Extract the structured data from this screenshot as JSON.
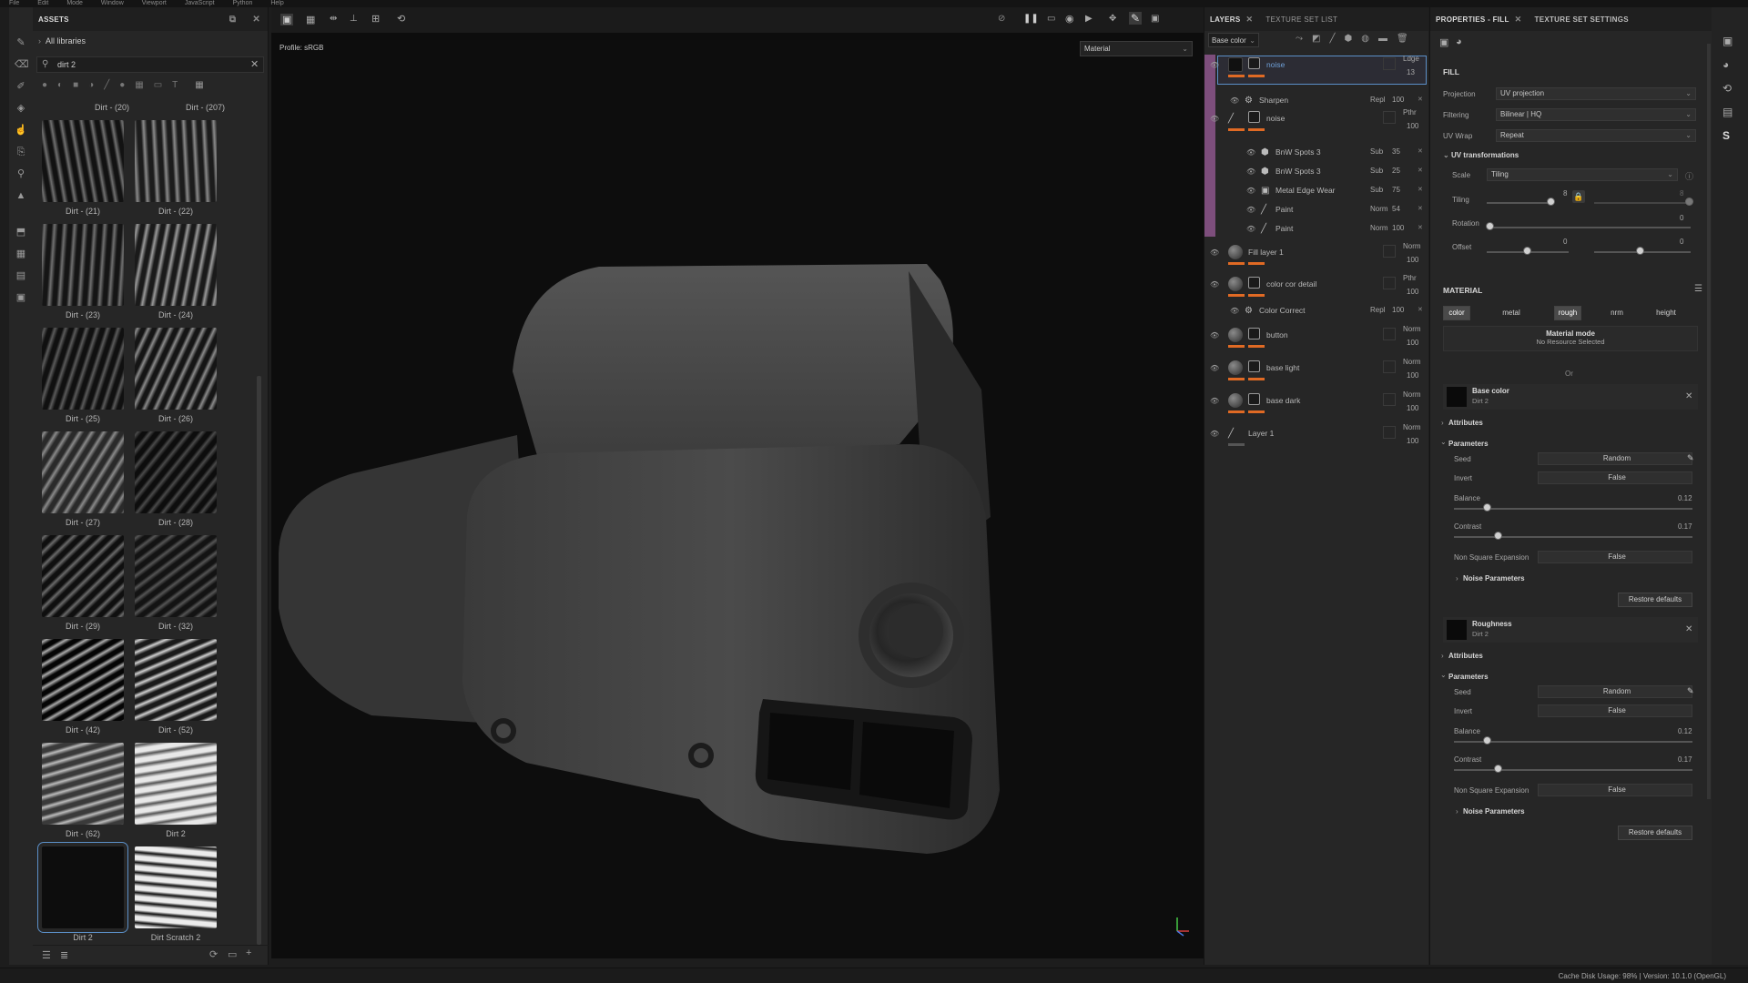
{
  "menubar": {
    "items": [
      "File",
      "Edit",
      "Mode",
      "Window",
      "Viewport",
      "JavaScript",
      "Python",
      "Help"
    ]
  },
  "assets": {
    "title": "ASSETS",
    "breadcrumb": "All libraries",
    "search_value": "dirt 2",
    "top_labels": [
      "Dirt - (20)",
      "Dirt - (207)"
    ],
    "items": [
      {
        "label": "Dirt - (21)"
      },
      {
        "label": "Dirt - (22)"
      },
      {
        "label": "Dirt - (23)"
      },
      {
        "label": "Dirt - (24)"
      },
      {
        "label": "Dirt - (25)"
      },
      {
        "label": "Dirt - (26)"
      },
      {
        "label": "Dirt - (27)"
      },
      {
        "label": "Dirt - (28)"
      },
      {
        "label": "Dirt - (29)"
      },
      {
        "label": "Dirt - (32)"
      },
      {
        "label": "Dirt - (42)"
      },
      {
        "label": "Dirt - (52)"
      },
      {
        "label": "Dirt - (62)"
      },
      {
        "label": "Dirt 2"
      },
      {
        "label": "Dirt 2"
      },
      {
        "label": "Dirt Scratch 2"
      }
    ]
  },
  "viewport": {
    "profile": "Profile: sRGB",
    "mode_select": "Material"
  },
  "layers": {
    "tab_layers": "LAYERS",
    "tab_texture_set_list": "TEXTURE SET LIST",
    "channel_select": "Base color",
    "rows": [
      {
        "name": "noise",
        "blend": "Ldge",
        "opacity": "13",
        "level": 0,
        "thumb": "dark",
        "selected": true
      },
      {
        "name": "Sharpen",
        "blend": "Repl",
        "opacity": "100",
        "level": 1,
        "thumb": "filter"
      },
      {
        "name": "noise",
        "blend": "Pthr",
        "opacity": "100",
        "level": 0,
        "thumb": "brush"
      },
      {
        "name": "BnW Spots 3",
        "blend": "Sub",
        "opacity": "35",
        "level": 2,
        "thumb": "fill"
      },
      {
        "name": "BnW Spots 3",
        "blend": "Sub",
        "opacity": "25",
        "level": 2,
        "thumb": "fill"
      },
      {
        "name": "Metal Edge Wear",
        "blend": "Sub",
        "opacity": "75",
        "level": 2,
        "thumb": "generator"
      },
      {
        "name": "Paint",
        "blend": "Norm",
        "opacity": "54",
        "level": 2,
        "thumb": "brush"
      },
      {
        "name": "Paint",
        "blend": "Norm",
        "opacity": "100",
        "level": 2,
        "thumb": "brush"
      },
      {
        "name": "Fill layer 1",
        "blend": "Norm",
        "opacity": "100",
        "level": 0,
        "thumb": "sphere"
      },
      {
        "name": "color cor detail",
        "blend": "Pthr",
        "opacity": "100",
        "level": 0,
        "thumb": "sphere"
      },
      {
        "name": "Color Correct",
        "blend": "Repl",
        "opacity": "100",
        "level": 1,
        "thumb": "filter"
      },
      {
        "name": "button",
        "blend": "Norm",
        "opacity": "100",
        "level": 0,
        "thumb": "sphere"
      },
      {
        "name": "base light",
        "blend": "Norm",
        "opacity": "100",
        "level": 0,
        "thumb": "sphere"
      },
      {
        "name": "base dark",
        "blend": "Norm",
        "opacity": "100",
        "level": 0,
        "thumb": "sphere"
      },
      {
        "name": "Layer 1",
        "blend": "Norm",
        "opacity": "100",
        "level": 0,
        "thumb": "brush"
      }
    ]
  },
  "properties": {
    "tab_props": "PROPERTIES - FILL",
    "tab_tss": "TEXTURE SET SETTINGS",
    "fill_title": "FILL",
    "projection_label": "Projection",
    "projection_value": "UV projection",
    "filtering_label": "Filtering",
    "filtering_value": "Bilinear | HQ",
    "uvwrap_label": "UV Wrap",
    "uvwrap_value": "Repeat",
    "uvtrans_title": "UV transformations",
    "scale_label": "Scale",
    "scale_value": "Tiling",
    "tiling_label": "Tiling",
    "tiling_val1": "8",
    "tiling_val2": "8",
    "rotation_label": "Rotation",
    "rotation_val": "0",
    "offset_label": "Offset",
    "offset_val1": "0",
    "offset_val2": "0",
    "material_title": "MATERIAL",
    "channels": [
      "color",
      "metal",
      "rough",
      "nrm",
      "height"
    ],
    "material_mode": "Material mode",
    "no_resource": "No Resource Selected",
    "or_text": "Or",
    "base_color": {
      "title": "Base color",
      "sub": "Dirt 2"
    },
    "roughness": {
      "title": "Roughness",
      "sub": "Dirt 2"
    },
    "attributes": "Attributes",
    "parameters": "Parameters",
    "seed_label": "Seed",
    "seed_value": "Random",
    "invert_label": "Invert",
    "invert_value": "False",
    "balance_label": "Balance",
    "balance_value": "0.12",
    "contrast_label": "Contrast",
    "contrast_value": "0.17",
    "nse_label": "Non Square Expansion",
    "nse_value": "False",
    "noise_params": "Noise Parameters",
    "restore": "Restore defaults"
  },
  "status": {
    "text": "Cache Disk Usage:   98% | Version: 10.1.0 (OpenGL)"
  },
  "colors": {
    "accent": "#e06a24",
    "selection": "#7d4e7c",
    "highlight": "#5b8fc7"
  }
}
